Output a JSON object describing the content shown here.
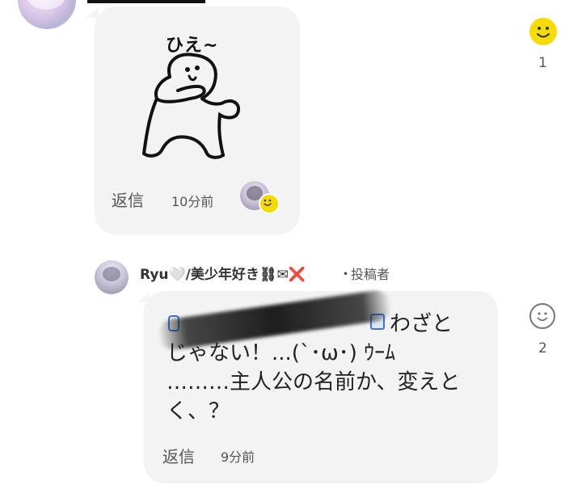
{
  "comment1": {
    "sticker_text": "ひえ~",
    "reply_label": "返信",
    "time": "10分前",
    "reaction_count": "1"
  },
  "comment2": {
    "username": "Ryu🤍/美少年好き⛓✉❌",
    "separator": "・",
    "author_tag": "投稿者",
    "message_lines": [
      "わざと",
      "じゃない！...(`･ω･) ｳｰﾑ",
      "………主人公の名前か、変えと",
      "く、？"
    ],
    "reply_label": "返信",
    "time": "9分前",
    "reaction_count": "2"
  },
  "colors": {
    "bubble": "#f3f3f3",
    "reaction_yellow": "#f6dc06",
    "link_blue": "#3a78d6"
  },
  "icons": [
    "smiley-reaction-icon",
    "smiley-outline-icon",
    "user-avatar",
    "sticker-image"
  ]
}
